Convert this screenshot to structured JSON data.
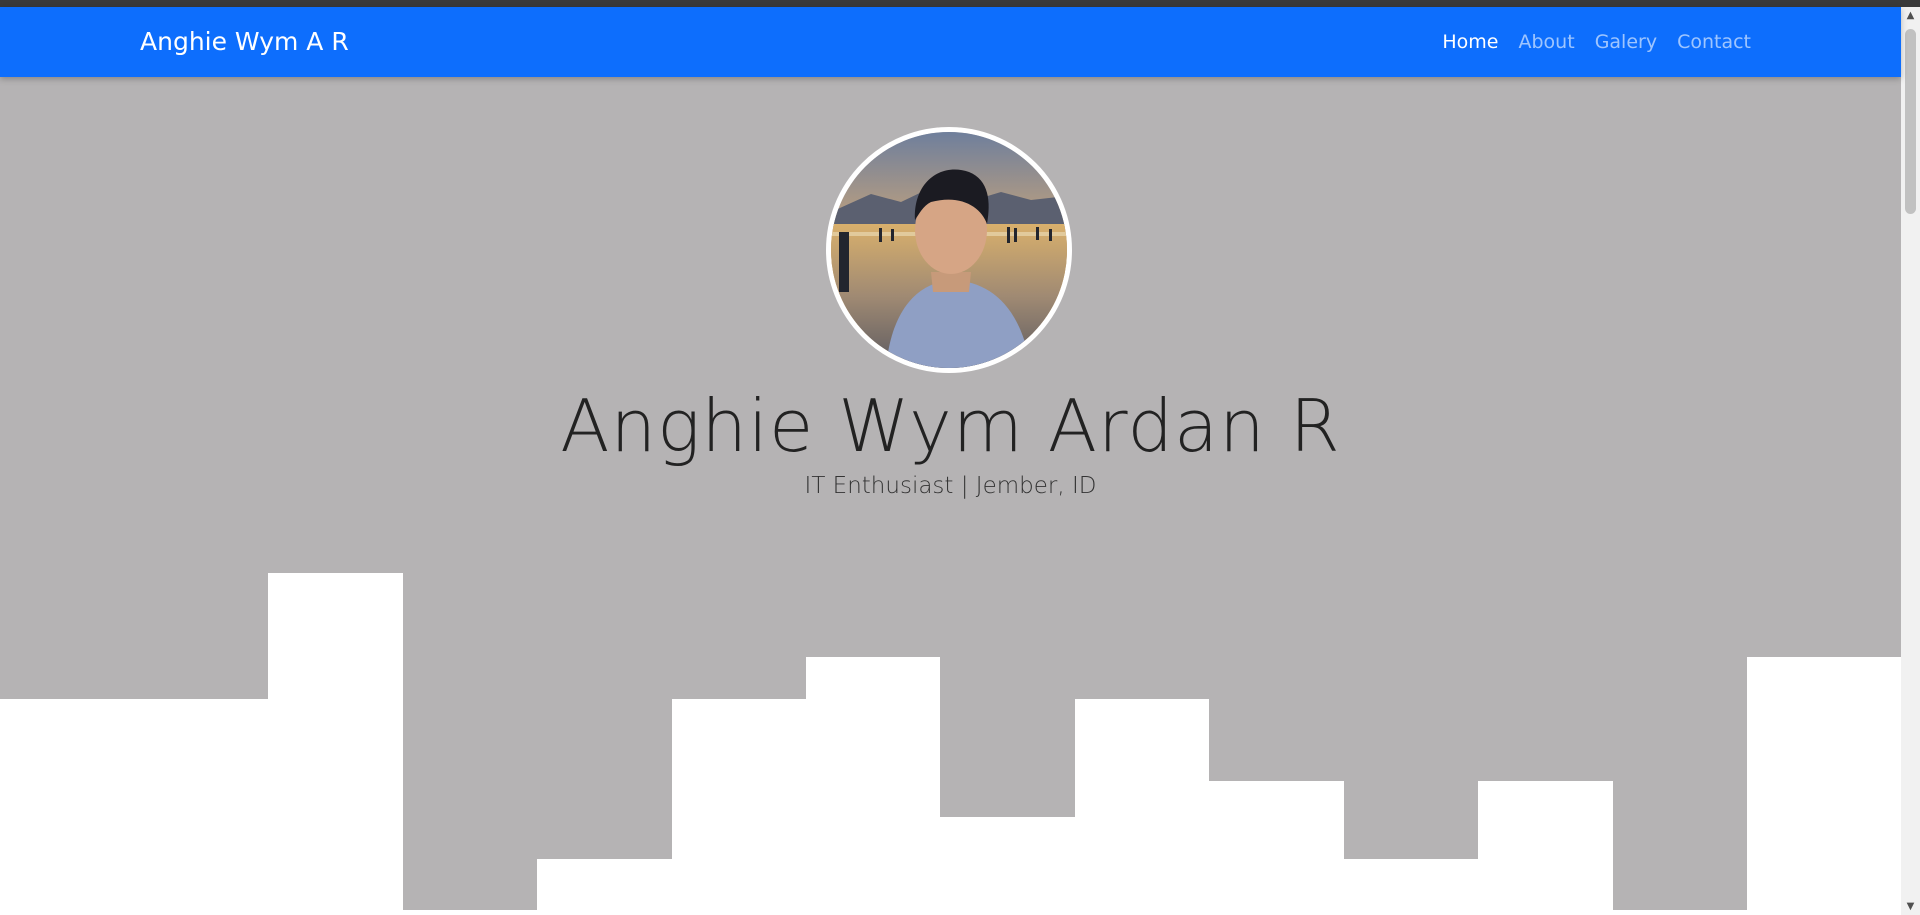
{
  "navbar": {
    "brand": "Anghie Wym A R",
    "links": [
      {
        "label": "Home",
        "active": true
      },
      {
        "label": "About",
        "active": false
      },
      {
        "label": "Galery",
        "active": false
      },
      {
        "label": "Contact",
        "active": false
      }
    ]
  },
  "hero": {
    "title": "Anghie Wym Ardan R",
    "subtitle": "IT Enthusiast | Jember, ID"
  },
  "colors": {
    "navbar_bg": "#0d6efd",
    "hero_bg": "#b5b3b4",
    "wave_fill": "#ffffff"
  },
  "icons": {
    "scroll_up": "▲",
    "scroll_down": "▼"
  }
}
